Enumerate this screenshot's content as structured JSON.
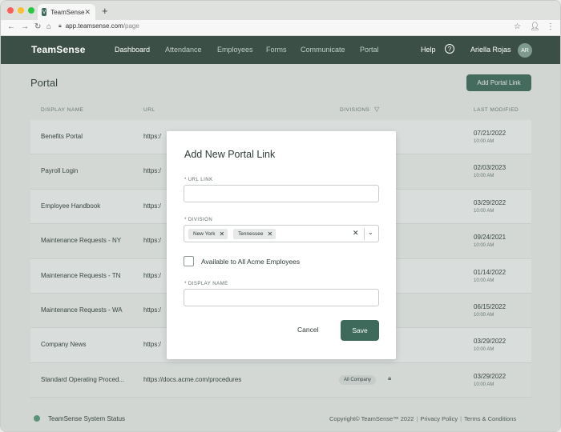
{
  "browser": {
    "tab_title": "TeamSense",
    "tab_favicon": "V",
    "url_host": "app.teamsense.com",
    "url_path": "/page",
    "traffic_lights": [
      "#ff5f57",
      "#febc2e",
      "#28c840"
    ]
  },
  "nav": {
    "logo": "TeamSense",
    "items": [
      {
        "label": "Dashboard",
        "active": true
      },
      {
        "label": "Attendance",
        "active": false
      },
      {
        "label": "Employees",
        "active": false
      },
      {
        "label": "Forms",
        "active": false
      },
      {
        "label": "Communicate",
        "active": false
      },
      {
        "label": "Portal",
        "active": false
      }
    ],
    "help_label": "Help",
    "user_name": "Ariella Rojas",
    "user_initials": "AR"
  },
  "page": {
    "title": "Portal",
    "add_button_label": "Add Portal Link",
    "columns": {
      "display_name": "DISPLAY NAME",
      "url": "URL",
      "divisions": "DIVISIONS",
      "last_modified": "LAST MODIFIED"
    },
    "rows": [
      {
        "name": "Benefits Portal",
        "url": "https:/",
        "date": "07/21/2022",
        "time": "10:00 AM"
      },
      {
        "name": "Payroll Login",
        "url": "https:/",
        "date": "02/03/2023",
        "time": "10:00 AM"
      },
      {
        "name": "Employee Handbook",
        "url": "https:/",
        "date": "03/29/2022",
        "time": "10:00 AM"
      },
      {
        "name": "Maintenance Requests - NY",
        "url": "https:/",
        "date": "09/24/2021",
        "time": "10:00 AM"
      },
      {
        "name": "Maintenance Requests - TN",
        "url": "https:/",
        "date": "01/14/2022",
        "time": "10:00 AM"
      },
      {
        "name": "Maintenance Requests - WA",
        "url": "https:/",
        "date": "06/15/2022",
        "time": "10:00 AM"
      },
      {
        "name": "Company News",
        "url": "https:/",
        "date": "03/29/2022",
        "time": "10:00 AM"
      },
      {
        "name": "Standard Operating Proced...",
        "url": "https://docs.acme.com/procedures",
        "badge": "All Company",
        "date": "03/29/2022",
        "time": "10:00 AM"
      }
    ]
  },
  "footer": {
    "status": "TeamSense System Status",
    "copyright": "Copyright© TeamSense™ 2022",
    "privacy": "Privacy Policy",
    "terms": "Terms & Conditions"
  },
  "modal": {
    "title": "Add New Portal Link",
    "url_label": "URL LINK",
    "url_value": "",
    "division_label": "DIVISION",
    "division_chips": [
      "New York",
      "Tennessee"
    ],
    "checkbox_label": "Available to All Acme Employees",
    "checkbox_checked": false,
    "display_name_label": "DISPLAY NAME",
    "display_name_value": "",
    "cancel_label": "Cancel",
    "save_label": "Save"
  },
  "colors": {
    "nav_bg": "#3b4f47",
    "accent": "#3e6a5b",
    "status_ok": "#5c9b7d"
  }
}
